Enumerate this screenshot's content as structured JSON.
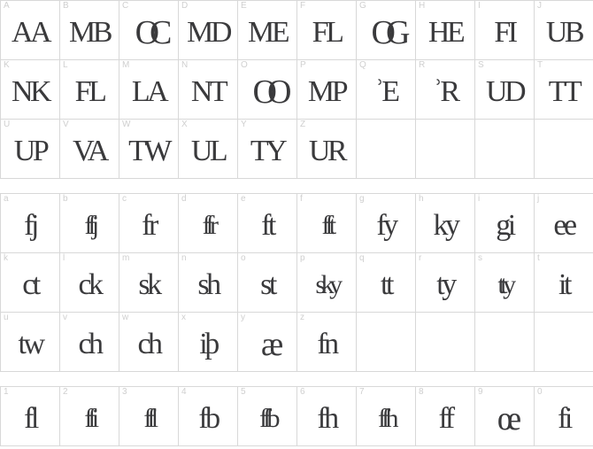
{
  "view": {
    "title": "Ligature Glyph Grid",
    "background_color": "#ffffff",
    "grid_line_color": "#d8d8d8",
    "index_label_color": "#cfcfcf",
    "glyph_color": "#3a3a3c",
    "columns_per_row": 10
  },
  "grids": [
    {
      "name": "uppercase-ligatures",
      "index_style": "uppercase-letters",
      "cells": [
        {
          "index": "A",
          "glyph": "AA"
        },
        {
          "index": "B",
          "glyph": "MB"
        },
        {
          "index": "C",
          "glyph": "OC"
        },
        {
          "index": "D",
          "glyph": "MD"
        },
        {
          "index": "E",
          "glyph": "ME"
        },
        {
          "index": "F",
          "glyph": "FL"
        },
        {
          "index": "G",
          "glyph": "OG"
        },
        {
          "index": "H",
          "glyph": "HE"
        },
        {
          "index": "I",
          "glyph": "FI"
        },
        {
          "index": "J",
          "glyph": "UB"
        },
        {
          "index": "K",
          "glyph": "NK"
        },
        {
          "index": "L",
          "glyph": "FL"
        },
        {
          "index": "M",
          "glyph": "LA"
        },
        {
          "index": "N",
          "glyph": "NT"
        },
        {
          "index": "O",
          "glyph": "OO"
        },
        {
          "index": "P",
          "glyph": "MP"
        },
        {
          "index": "Q",
          "glyph": "ʾE"
        },
        {
          "index": "R",
          "glyph": "ʾR"
        },
        {
          "index": "S",
          "glyph": "UD"
        },
        {
          "index": "T",
          "glyph": "TT"
        },
        {
          "index": "U",
          "glyph": "UP"
        },
        {
          "index": "V",
          "glyph": "VA"
        },
        {
          "index": "W",
          "glyph": "TW"
        },
        {
          "index": "X",
          "glyph": "UL"
        },
        {
          "index": "Y",
          "glyph": "TY"
        },
        {
          "index": "Z",
          "glyph": "UR"
        },
        {
          "index": "",
          "glyph": ""
        },
        {
          "index": "",
          "glyph": ""
        },
        {
          "index": "",
          "glyph": ""
        },
        {
          "index": "",
          "glyph": ""
        }
      ]
    },
    {
      "name": "lowercase-ligatures",
      "index_style": "lowercase-letters",
      "cells": [
        {
          "index": "a",
          "glyph": "fj"
        },
        {
          "index": "b",
          "glyph": "ffj"
        },
        {
          "index": "c",
          "glyph": "fr"
        },
        {
          "index": "d",
          "glyph": "ffr"
        },
        {
          "index": "e",
          "glyph": "ft"
        },
        {
          "index": "f",
          "glyph": "fft"
        },
        {
          "index": "g",
          "glyph": "fy"
        },
        {
          "index": "h",
          "glyph": "ky"
        },
        {
          "index": "i",
          "glyph": "gi"
        },
        {
          "index": "j",
          "glyph": "ee"
        },
        {
          "index": "k",
          "glyph": "ct"
        },
        {
          "index": "l",
          "glyph": "ck"
        },
        {
          "index": "m",
          "glyph": "sk"
        },
        {
          "index": "n",
          "glyph": "sh"
        },
        {
          "index": "o",
          "glyph": "st"
        },
        {
          "index": "p",
          "glyph": "sky"
        },
        {
          "index": "q",
          "glyph": "tt"
        },
        {
          "index": "r",
          "glyph": "ty"
        },
        {
          "index": "s",
          "glyph": "tty"
        },
        {
          "index": "t",
          "glyph": "it"
        },
        {
          "index": "u",
          "glyph": "tw"
        },
        {
          "index": "v",
          "glyph": "ch"
        },
        {
          "index": "w",
          "glyph": "ch"
        },
        {
          "index": "x",
          "glyph": "iþ"
        },
        {
          "index": "y",
          "glyph": "æ"
        },
        {
          "index": "z",
          "glyph": "fn"
        },
        {
          "index": "",
          "glyph": ""
        },
        {
          "index": "",
          "glyph": ""
        },
        {
          "index": "",
          "glyph": ""
        },
        {
          "index": "",
          "glyph": ""
        }
      ]
    },
    {
      "name": "numeric-ligatures",
      "index_style": "digits",
      "cells": [
        {
          "index": "1",
          "glyph": "fl"
        },
        {
          "index": "2",
          "glyph": "ffi"
        },
        {
          "index": "3",
          "glyph": "ffl"
        },
        {
          "index": "4",
          "glyph": "fb"
        },
        {
          "index": "5",
          "glyph": "ffb"
        },
        {
          "index": "6",
          "glyph": "fh"
        },
        {
          "index": "7",
          "glyph": "ffh"
        },
        {
          "index": "8",
          "glyph": "ff"
        },
        {
          "index": "9",
          "glyph": "œ"
        },
        {
          "index": "0",
          "glyph": "fi"
        }
      ]
    }
  ]
}
